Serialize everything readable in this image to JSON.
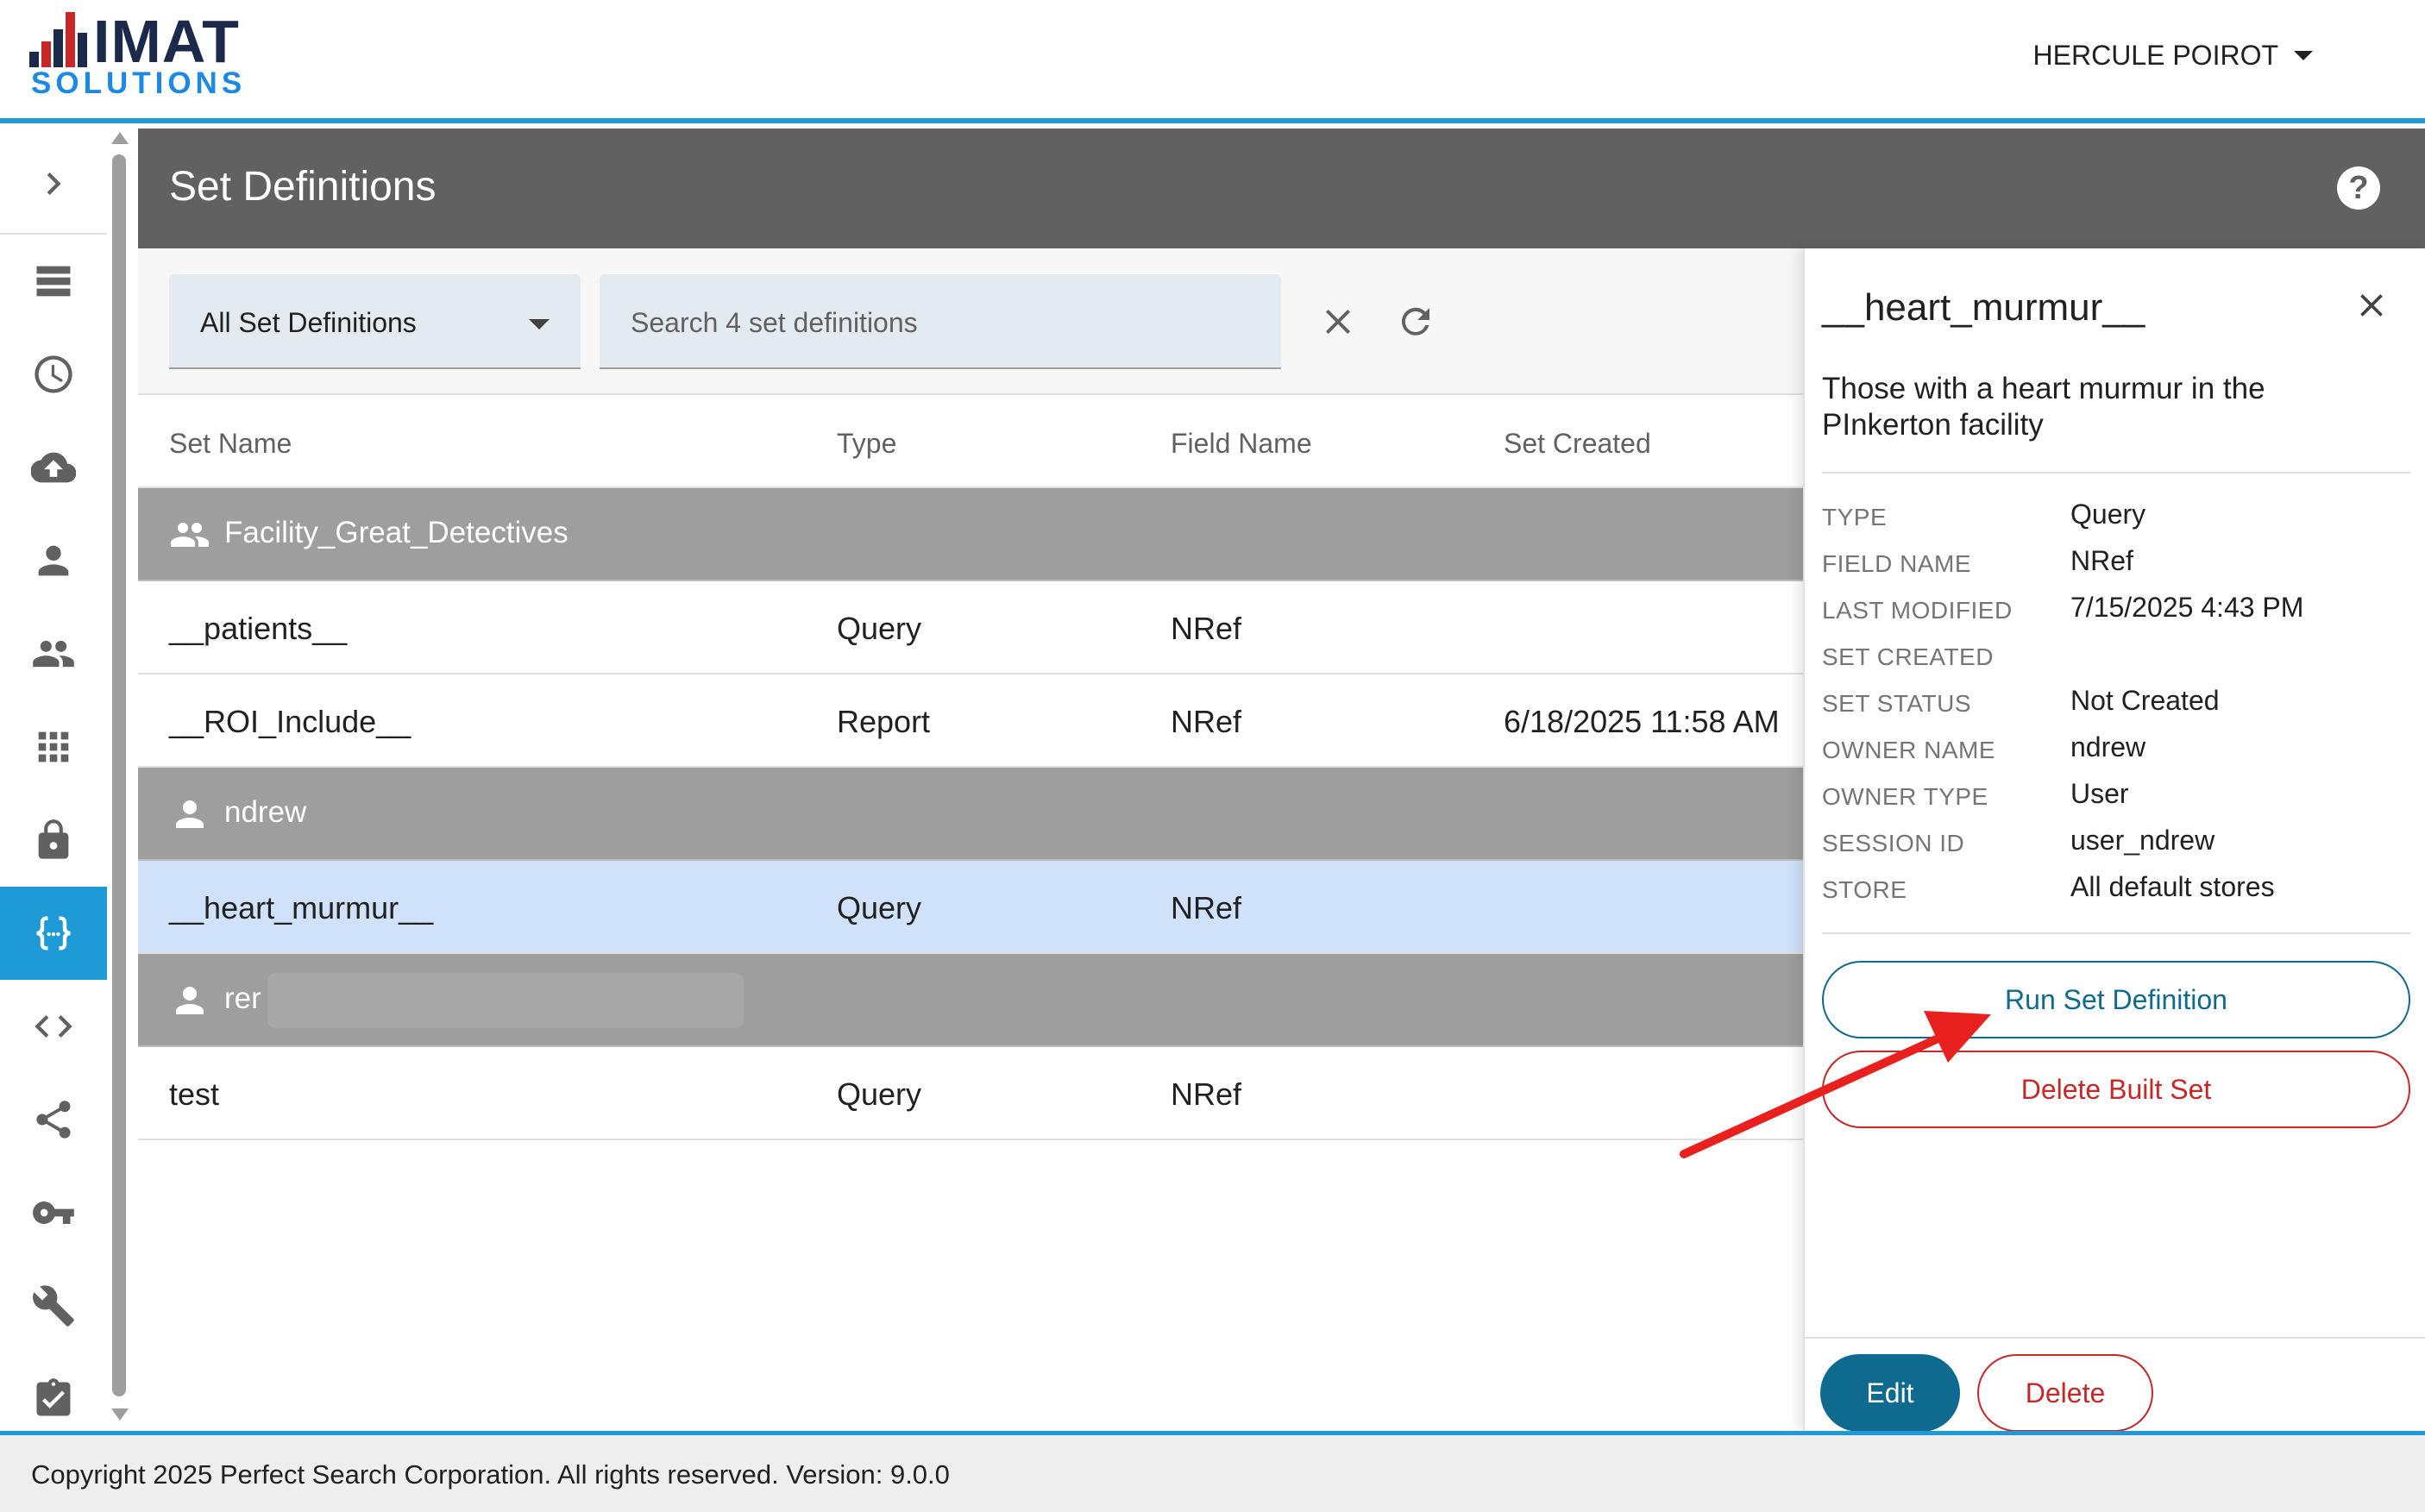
{
  "brand": {
    "logo_word_1": "IMAT",
    "logo_word_2": "SOLUTIONS",
    "bar_colors": [
      "#1b2a4a",
      "#c62828",
      "#1b2a4a",
      "#1e88e5",
      "#c62828",
      "#1b2a4a"
    ],
    "accent_color": "#1e9bd7"
  },
  "header": {
    "user_name": "HERCULE POIROT"
  },
  "rail": {
    "items": [
      {
        "icon": "chevron-right-icon"
      },
      {
        "icon": "list-icon"
      },
      {
        "icon": "clock-icon"
      },
      {
        "icon": "cloud-upload-icon"
      },
      {
        "icon": "person-icon"
      },
      {
        "icon": "people-icon"
      },
      {
        "icon": "apps-grid-icon"
      },
      {
        "icon": "lock-icon"
      },
      {
        "icon": "curly-braces-icon",
        "active": true
      },
      {
        "icon": "code-icon"
      },
      {
        "icon": "share-icon"
      },
      {
        "icon": "key-icon"
      },
      {
        "icon": "wrench-icon"
      },
      {
        "icon": "assignment-check-icon"
      }
    ]
  },
  "page": {
    "title": "Set Definitions",
    "help_icon": "help-circle-icon"
  },
  "toolbar": {
    "filter_value": "All Set Definitions",
    "search_placeholder": "Search 4 set definitions",
    "clear_icon": "close-icon",
    "refresh_icon": "refresh-icon"
  },
  "table": {
    "columns": [
      "Set Name",
      "Type",
      "Field Name",
      "Set Created"
    ],
    "groups": [
      {
        "label": "Facility_Great_Detectives",
        "icon": "people-icon",
        "rows": [
          {
            "name": "__patients__",
            "type": "Query",
            "field": "NRef",
            "created": ""
          },
          {
            "name": "__ROI_Include__",
            "type": "Report",
            "field": "NRef",
            "created": "6/18/2025 11:58 AM"
          }
        ]
      },
      {
        "label": "ndrew",
        "icon": "person-icon",
        "rows": [
          {
            "name": "__heart_murmur__",
            "type": "Query",
            "field": "NRef",
            "created": "",
            "selected": true
          }
        ]
      },
      {
        "label": "rer",
        "icon": "person-icon",
        "redacted": true,
        "rows": [
          {
            "name": "test",
            "type": "Query",
            "field": "NRef",
            "created": ""
          }
        ]
      }
    ]
  },
  "detail": {
    "title": "__heart_murmur__",
    "description": "Those with a heart murmur in the PInkerton facility",
    "properties": [
      {
        "key": "TYPE",
        "value": "Query"
      },
      {
        "key": "FIELD NAME",
        "value": "NRef"
      },
      {
        "key": "LAST MODIFIED",
        "value": "7/15/2025 4:43 PM"
      },
      {
        "key": "SET CREATED",
        "value": ""
      },
      {
        "key": "SET STATUS",
        "value": "Not Created"
      },
      {
        "key": "OWNER NAME",
        "value": "ndrew"
      },
      {
        "key": "OWNER TYPE",
        "value": "User"
      },
      {
        "key": "SESSION ID",
        "value": "user_ndrew"
      },
      {
        "key": "STORE",
        "value": "All default stores"
      }
    ],
    "run_label": "Run Set Definition",
    "delete_built_label": "Delete Built Set",
    "edit_label": "Edit",
    "delete_label": "Delete",
    "annotation_arrow_color": "#e8211f"
  },
  "footer": {
    "text": "Copyright 2025 Perfect Search Corporation. All rights reserved. Version: 9.0.0"
  }
}
